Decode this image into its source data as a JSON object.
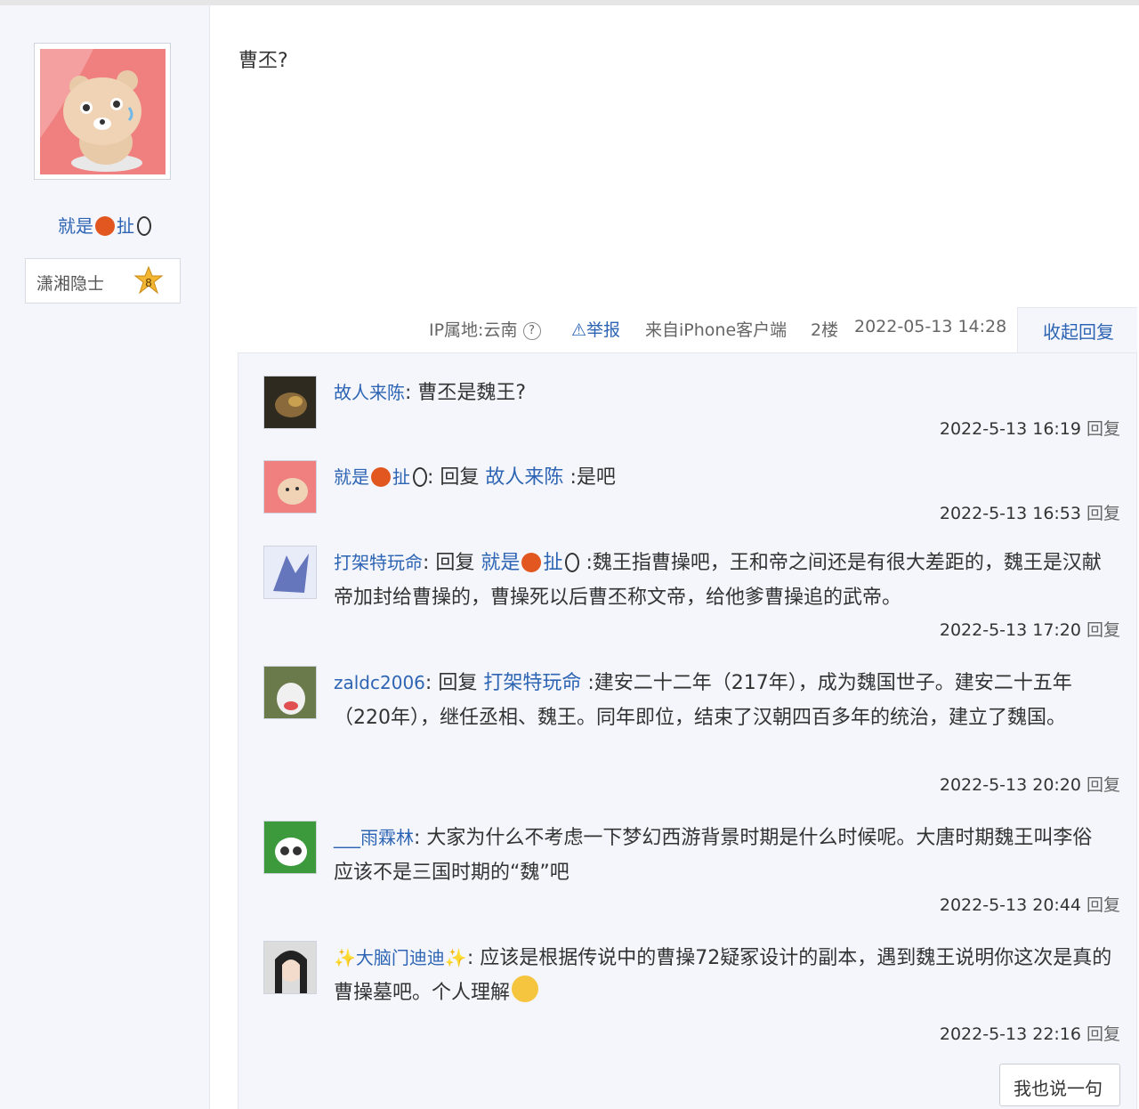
{
  "author": {
    "name": "就是",
    "name_suffix": "扯",
    "badge_label": "潇湘隐士",
    "badge_level": "8"
  },
  "post": {
    "text": "曹丕?"
  },
  "meta": {
    "ip": "IP属地:云南",
    "report": "举报",
    "source": "来自iPhone客户端",
    "floor": "2楼",
    "time": "2022-05-13 14:28",
    "collapse": "收起回复"
  },
  "replies": [
    {
      "name": "故人来陈",
      "prefix": "",
      "at": "",
      "text": "曹丕是魏王?",
      "time": "2022-5-13 16:19",
      "reply": "回复"
    },
    {
      "name_a": "就是",
      "name_b": "扯",
      "prefix": "回复",
      "at": "故人来陈",
      "text": ":是吧",
      "time": "2022-5-13 16:53",
      "reply": "回复"
    },
    {
      "name": "打架特玩命",
      "prefix": "回复",
      "at_a": "就是",
      "at_b": "扯",
      "text": ":魏王指曹操吧，王和帝之间还是有很大差距的，魏王是汉献帝加封给曹操的，曹操死以后曹丕称文帝，给他爹曹操追的武帝。",
      "time": "2022-5-13 17:20",
      "reply": "回复"
    },
    {
      "name": "zaldc2006",
      "prefix": "回复",
      "at": "打架特玩命",
      "text": ":建安二十二年（217年），成为魏国世子。建安二十五年（220年），继任丞相、魏王。同年即位，结束了汉朝四百多年的统治，建立了魏国。",
      "time": "2022-5-13 20:20",
      "reply": "回复"
    },
    {
      "name": "___雨霖林",
      "prefix": "",
      "at": "",
      "text": "大家为什么不考虑一下梦幻西游背景时期是什么时候呢。大唐时期魏王叫李俗 应该不是三国时期的“魏”吧",
      "time": "2022-5-13 20:44",
      "reply": "回复"
    },
    {
      "name": "大脑门迪迪",
      "prefix": "",
      "at": "",
      "text": "应该是根据传说中的曹操72疑冢设计的副本，遇到魏王说明你这次是真的曹操墓吧。个人理解",
      "time": "2022-5-13 22:16",
      "reply": "回复"
    }
  ],
  "say_button": "我也说一句",
  "colors": {
    "link": "#2d64b3",
    "panel": "#f4f6fb"
  }
}
